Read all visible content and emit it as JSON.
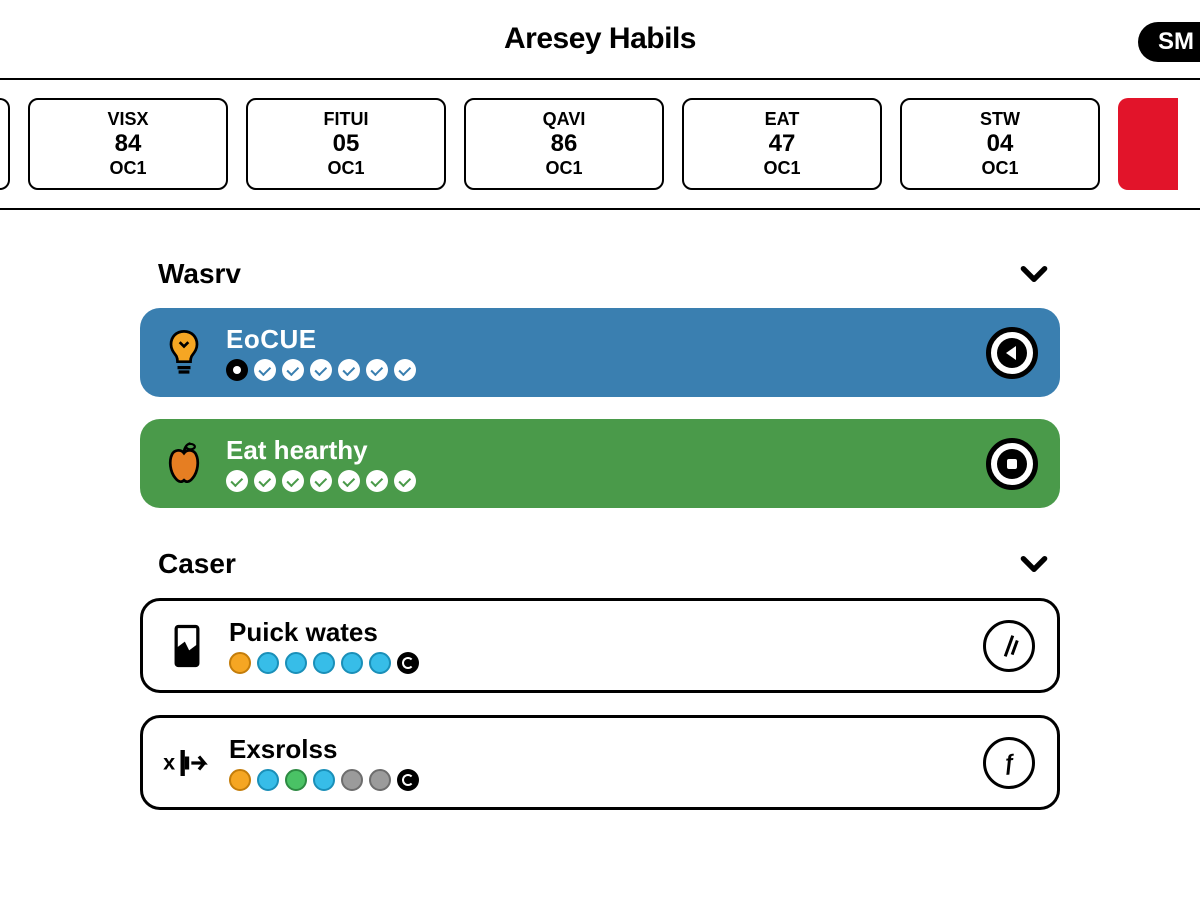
{
  "header": {
    "title": "Aresey Habils",
    "pill": "SM"
  },
  "dates": [
    {
      "dow": "",
      "num": "",
      "mon": "",
      "partial": "left"
    },
    {
      "dow": "VISX",
      "num": "84",
      "mon": "OC1"
    },
    {
      "dow": "FITUI",
      "num": "05",
      "mon": "OC1"
    },
    {
      "dow": "QAVI",
      "num": "86",
      "mon": "OC1"
    },
    {
      "dow": "EAT",
      "num": "47",
      "mon": "OC1"
    },
    {
      "dow": "STW",
      "num": "04",
      "mon": "OC1"
    },
    {
      "dow": "",
      "num": "",
      "mon": "",
      "partial": "right"
    }
  ],
  "sections": [
    {
      "title": "Wasrv",
      "habits": [
        {
          "name": "focue",
          "title": "EoCUE",
          "style": "blue",
          "icon": "lightbulb",
          "dots": [
            "solid-black",
            "w-check",
            "w-check",
            "w-check",
            "w-check",
            "w-check",
            "w-check"
          ],
          "action": "play"
        },
        {
          "name": "eat-healthy",
          "title": "Eat hearthy",
          "style": "green",
          "icon": "apple",
          "dots": [
            "w-check",
            "w-check",
            "w-check",
            "w-check",
            "w-check",
            "w-check",
            "w-check"
          ],
          "action": "stop"
        }
      ]
    },
    {
      "title": "Caser",
      "habits": [
        {
          "name": "drink-water",
          "title": "Puick wates",
          "style": "outline",
          "icon": "water",
          "dots": [
            "orange",
            "cyan",
            "cyan",
            "cyan",
            "cyan",
            "cyan",
            "black-ring"
          ],
          "action": "slash"
        },
        {
          "name": "exercise",
          "title": "Exsrolss",
          "style": "outline",
          "icon": "exercise",
          "dots": [
            "orange",
            "cyan",
            "green2",
            "cyan",
            "gray",
            "gray",
            "black-ring"
          ],
          "action": "f"
        }
      ]
    }
  ]
}
